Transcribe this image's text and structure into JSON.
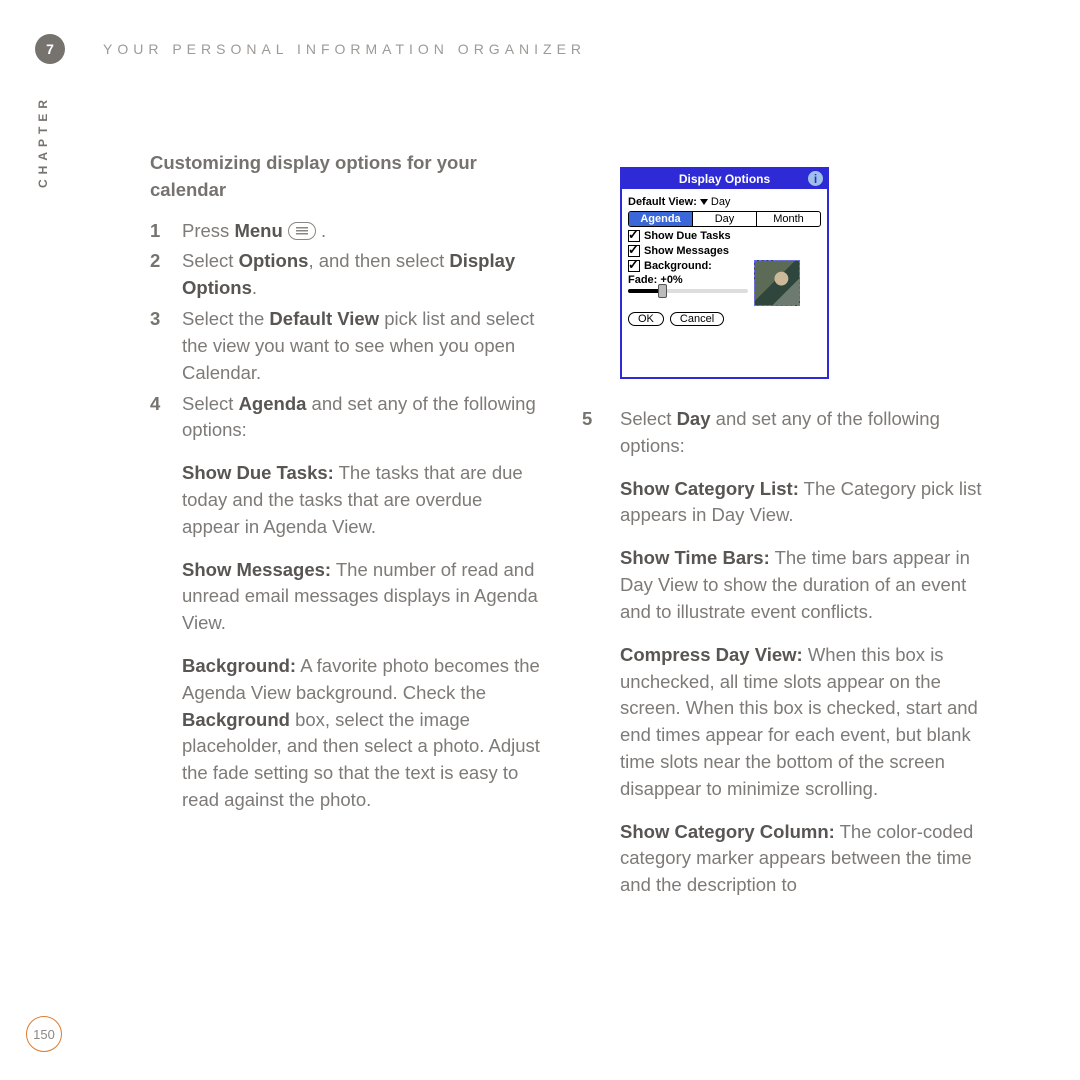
{
  "chapter_number": "7",
  "chapter_label_vertical": "CHAPTER",
  "header_title": "YOUR PERSONAL INFORMATION ORGANIZER",
  "page_number": "150",
  "left": {
    "heading": "Customizing display options for your calendar",
    "step1_num": "1",
    "step1_a": "Press ",
    "step1_b": "Menu",
    "step1_c": " .",
    "step2_num": "2",
    "step2_a": "Select ",
    "step2_b": "Options",
    "step2_c": ", and then select ",
    "step2_d": "Display Options",
    "step2_e": ".",
    "step3_num": "3",
    "step3_a": "Select the ",
    "step3_b": "Default View",
    "step3_c": " pick list and select the view you want to see when you open Calendar.",
    "step4_num": "4",
    "step4_a": "Select ",
    "step4_b": "Agenda",
    "step4_c": " and set any of the following options:",
    "p1_b": "Show Due Tasks:",
    "p1_t": " The tasks that are due today and the tasks that are overdue appear in Agenda View.",
    "p2_b": "Show Messages:",
    "p2_t": " The number of read and unread email messages displays in Agenda View.",
    "p3_b1": "Background:",
    "p3_t1": " A favorite photo becomes the Agenda View background. Check the ",
    "p3_b2": "Background",
    "p3_t2": " box, select the image placeholder, and then select a photo. Adjust the fade setting so that the text is easy to read against the photo."
  },
  "right": {
    "step5_num": "5",
    "step5_a": "Select ",
    "step5_b": "Day",
    "step5_c": " and set any of the following options:",
    "p1_b": "Show Category List:",
    "p1_t": " The Category pick list appears in Day View.",
    "p2_b": "Show Time Bars:",
    "p2_t": " The time bars appear in Day View to show the duration of an event and to illustrate event conflicts.",
    "p3_b": "Compress Day View:",
    "p3_t": " When this box is unchecked, all time slots appear on the screen. When this box is checked, start and end times appear for each event, but blank time slots near the bottom of the screen disappear to minimize scrolling.",
    "p4_b": "Show Category Column:",
    "p4_t": " The color-coded category marker appears between the time and the description to"
  },
  "dialog": {
    "title": "Display Options",
    "default_view_label": "Default View:",
    "default_view_value": "Day",
    "tabs": {
      "agenda": "Agenda",
      "day": "Day",
      "month": "Month"
    },
    "show_due_tasks": "Show Due Tasks",
    "show_messages": "Show Messages",
    "background": "Background:",
    "fade_label": "Fade:  +0%",
    "ok": "OK",
    "cancel": "Cancel",
    "info_glyph": "i"
  }
}
